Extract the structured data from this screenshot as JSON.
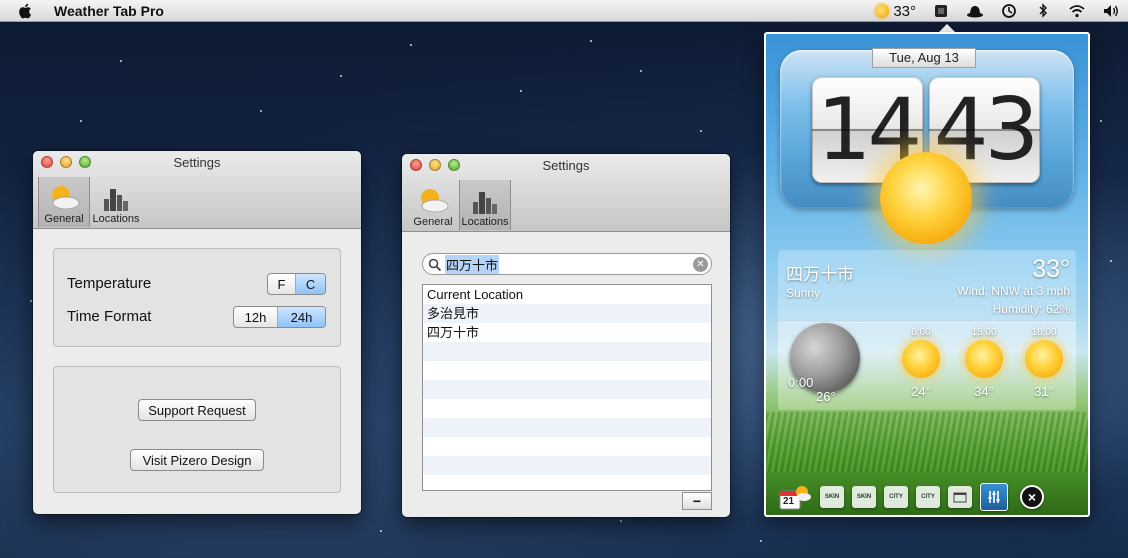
{
  "menubar": {
    "app_name": "Weather Tab Pro",
    "temp": "33°",
    "icons": [
      "apple-icon",
      "weather-sun-icon",
      "cube-icon",
      "hat-icon",
      "time-machine-icon",
      "bluetooth-icon",
      "wifi-icon",
      "volume-icon"
    ]
  },
  "settings_general": {
    "title": "Settings",
    "tabs": [
      {
        "label": "General",
        "icon": "weather-icon"
      },
      {
        "label": "Locations",
        "icon": "city-icon"
      }
    ],
    "temperature_label": "Temperature",
    "temperature_options": [
      "F",
      "C"
    ],
    "temperature_selected": "C",
    "time_format_label": "Time Format",
    "time_format_options": [
      "12h",
      "24h"
    ],
    "time_format_selected": "24h",
    "support_button": "Support Request",
    "visit_button": "Visit Pizero Design"
  },
  "settings_locations": {
    "title": "Settings",
    "tabs": [
      {
        "label": "General",
        "icon": "weather-icon"
      },
      {
        "label": "Locations",
        "icon": "city-icon"
      }
    ],
    "search_value": "四万十市",
    "locations": [
      "Current Location",
      "多治見市",
      "四万十市"
    ],
    "remove_button": "−"
  },
  "widget": {
    "date": "Tue, Aug 13",
    "hours": "14",
    "minutes": "43",
    "city": "四万十市",
    "condition": "Sunny",
    "temperature": "33°",
    "wind": "Wind: NNW at 3 mph",
    "humidity": "Humidity: 62%",
    "now": {
      "time": "0:00",
      "temp": "26°"
    },
    "forecast": [
      {
        "time": "6:00",
        "temp": "24°"
      },
      {
        "time": "15:00",
        "temp": "34°"
      },
      {
        "time": "18:00",
        "temp": "31°"
      }
    ],
    "toolbar": {
      "calendar_day": "21",
      "skin_label": "SKIN",
      "city_label": "CITY",
      "close": "×"
    }
  }
}
